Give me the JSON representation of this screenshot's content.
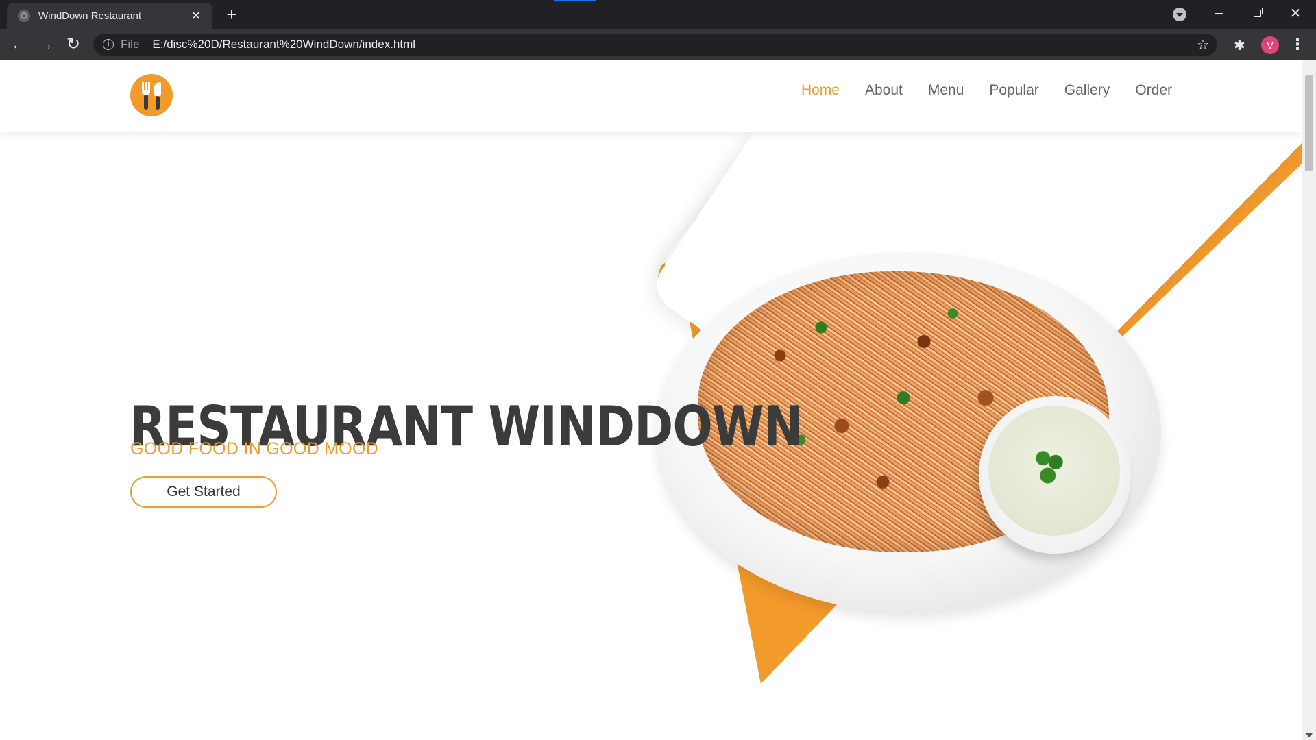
{
  "browser": {
    "tab_title": "WindDown Restaurant",
    "tab_close_icon": "close-icon",
    "new_tab_icon": "plus-icon",
    "scheme_label": "File",
    "url": "E:/disc%20D/Restaurant%20WindDown/index.html",
    "profile_initial": "V",
    "colors": {
      "profile_avatar": "#e2447a",
      "chrome_dark": "#202124",
      "chrome_toolbar": "#35363a"
    }
  },
  "site": {
    "nav": [
      "Home",
      "About",
      "Menu",
      "Popular",
      "Gallery",
      "Order"
    ],
    "active_nav": "Home",
    "logo_icon": "fork-knife-icon",
    "hero": {
      "title": "RESTAURANT WINDDOWN",
      "subtitle": "GOOD FOOD IN GOOD MOOD",
      "cta_label": "Get Started"
    },
    "colors": {
      "accent": "#f39a2c",
      "heading": "#3b3b3b",
      "nav_text": "#666666"
    }
  }
}
